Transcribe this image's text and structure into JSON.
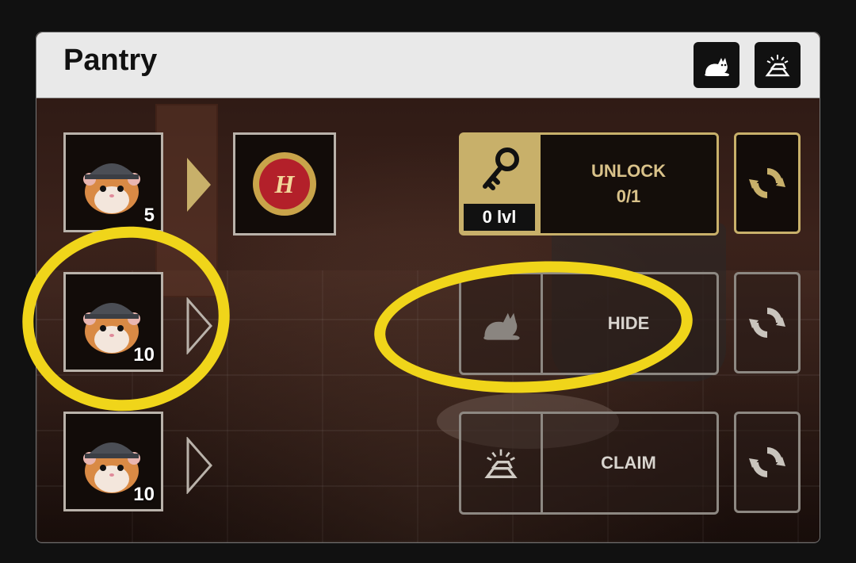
{
  "pantry": {
    "title": "Pantry",
    "header_icons": [
      "cat-icon",
      "gold-bars-icon"
    ],
    "rows": [
      {
        "level": "5",
        "reward_icon": "coin-h-icon",
        "action": {
          "label_line1": "UNLOCK",
          "label_line2": "0/1",
          "level_tag": "0 lvl",
          "icon": "key-icon"
        },
        "refresh_icon": "refresh-icon"
      },
      {
        "level": "10",
        "action": {
          "label": "HIDE",
          "icon": "cat-icon"
        },
        "refresh_icon": "refresh-icon"
      },
      {
        "level": "10",
        "action": {
          "label": "CLAIM",
          "icon": "gold-bars-icon"
        },
        "refresh_icon": "refresh-icon"
      }
    ]
  },
  "colors": {
    "gold": "#c8b06a",
    "highlight": "#f0d51a"
  }
}
